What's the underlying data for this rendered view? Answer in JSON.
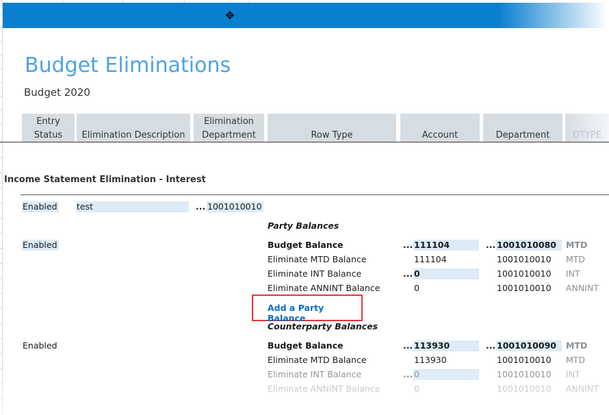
{
  "title": "Budget Eliminations",
  "subtitle": "Budget 2020",
  "columns": [
    {
      "line1": "Entry",
      "line2": "Status"
    },
    {
      "line1": "",
      "line2": "Elimination Description"
    },
    {
      "line1": "Elimination",
      "line2": "Department"
    },
    {
      "line1": "",
      "line2": "Row Type"
    },
    {
      "line1": "",
      "line2": "Account"
    },
    {
      "line1": "",
      "line2": "Department"
    },
    {
      "line1": "",
      "line2": "DTYPE"
    }
  ],
  "section_title": "Income Statement Elimination - Interest",
  "entry": {
    "status": "Enabled",
    "description": "test",
    "ellipsis": "...",
    "department": "1001010010"
  },
  "party": {
    "heading": "Party Balances",
    "status": "Enabled",
    "rows": [
      {
        "label": "Budget Balance",
        "ellipsis1": "...",
        "account": "111104",
        "ellipsis2": "...",
        "department": "1001010080",
        "dtype": "MTD"
      },
      {
        "label": "Eliminate MTD Balance",
        "account": "111104",
        "department": "1001010010",
        "dtype": "MTD"
      },
      {
        "label": "Eliminate INT Balance",
        "ellipsis1": "...",
        "account": "0",
        "department": "1001010010",
        "dtype": "INT"
      },
      {
        "label": "Eliminate ANNINT Balance",
        "account": "0",
        "department": "1001010010",
        "dtype": "ANNINT"
      }
    ],
    "add_link": "Add a Party Balance"
  },
  "counterparty": {
    "heading": "Counterparty Balances",
    "status": "Enabled",
    "rows": [
      {
        "label": "Budget Balance",
        "ellipsis1": "...",
        "account": "113930",
        "ellipsis2": "...",
        "department": "1001010090",
        "dtype": "MTD"
      },
      {
        "label": "Eliminate MTD Balance",
        "account": "113930",
        "department": "1001010010",
        "dtype": "MTD"
      },
      {
        "label": "Eliminate INT Balance",
        "ellipsis1": "...",
        "account": "0",
        "department": "1001010010",
        "dtype": "INT"
      },
      {
        "label": "Eliminate ANNINT Balance",
        "account": "0",
        "department": "1001010010",
        "dtype": "ANNINT"
      }
    ]
  },
  "colors": {
    "banner": "#0a7fd0",
    "title": "#4fa3e0",
    "header_bg": "#d5dde3",
    "cell_highlight": "#dcebf7",
    "link": "#0a6fc2",
    "callout_border": "#e0373a"
  },
  "icons": {
    "cursor": "move-cursor-icon"
  }
}
